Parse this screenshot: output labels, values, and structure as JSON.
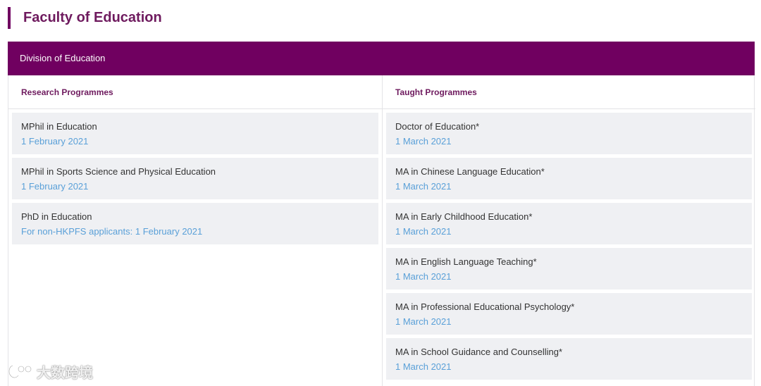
{
  "faculty": {
    "title": "Faculty of Education",
    "accent_color": "#700060"
  },
  "division": {
    "title": "Division of Education"
  },
  "research": {
    "header": "Research Programmes",
    "items": [
      {
        "name": "MPhil in Education",
        "date": "1 February 2021"
      },
      {
        "name": "MPhil in Sports Science and Physical Education",
        "date": "1 February 2021"
      },
      {
        "name": "PhD in Education",
        "date": "For non-HKPFS applicants: 1 February 2021"
      }
    ]
  },
  "taught": {
    "header": "Taught Programmes",
    "items": [
      {
        "name": "Doctor of Education*",
        "date": "1 March 2021"
      },
      {
        "name": "MA in Chinese Language Education*",
        "date": "1 March 2021"
      },
      {
        "name": "MA in Early Childhood Education*",
        "date": "1 March 2021"
      },
      {
        "name": "MA in English Language Teaching*",
        "date": "1 March 2021"
      },
      {
        "name": "MA in Professional Educational Psychology*",
        "date": "1 March 2021"
      },
      {
        "name": "MA in School Guidance and Counselling*",
        "date": "1 March 2021"
      }
    ]
  },
  "watermark": {
    "text": "大数跨境",
    "icon": "brand-logo-icon"
  },
  "colors": {
    "date_link": "#5aa0d8",
    "item_bg": "#eff0f3",
    "header_text": "#6e1a5e"
  }
}
